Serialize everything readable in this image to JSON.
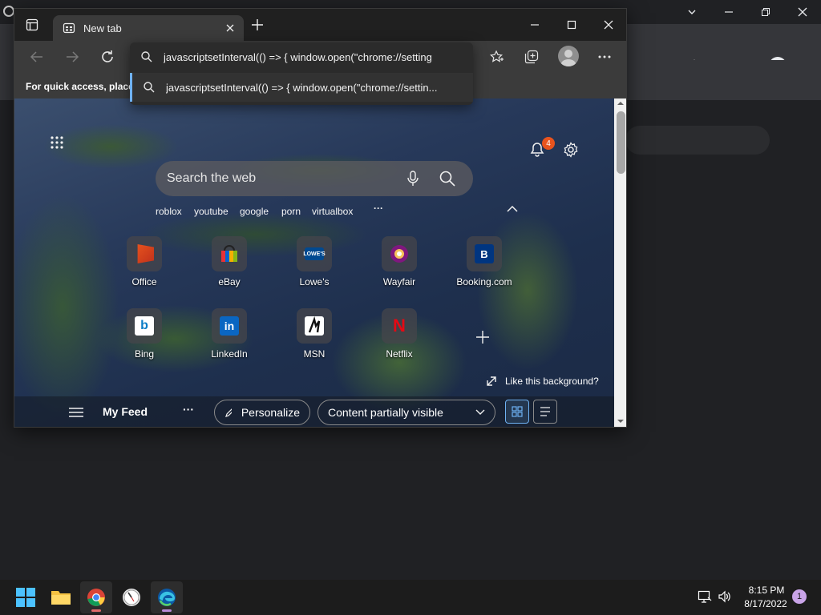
{
  "edge": {
    "tab_title": "New tab",
    "favorites_bar_text": "For quick access, place y",
    "omnibox": {
      "input_text": "javascriptsetInterval(() => { window.open(\"chrome://setting",
      "suggestion_text": "javascriptsetInterval(() => { window.open(\"chrome://settin..."
    },
    "ntp": {
      "search_placeholder": "Search the web",
      "notification_count": "4",
      "quick_links": [
        "roblox",
        "youtube",
        "google",
        "porn",
        "virtualbox"
      ],
      "quick_links_more": "···",
      "tiles": [
        {
          "label": "Office",
          "icon": "office-icon"
        },
        {
          "label": "eBay",
          "icon": "ebay-icon"
        },
        {
          "label": "Lowe's",
          "icon": "lowes-icon"
        },
        {
          "label": "Wayfair",
          "icon": "wayfair-icon"
        },
        {
          "label": "Booking.com",
          "icon": "booking-icon"
        },
        {
          "label": "Bing",
          "icon": "bing-icon"
        },
        {
          "label": "LinkedIn",
          "icon": "linkedin-icon"
        },
        {
          "label": "MSN",
          "icon": "msn-icon"
        },
        {
          "label": "Netflix",
          "icon": "netflix-icon"
        }
      ],
      "like_background": "Like this background?",
      "feed": {
        "title": "My Feed",
        "more": "···",
        "personalize": "Personalize",
        "content_visibility": "Content partially visible"
      }
    }
  },
  "taskbar": {
    "time": "8:15 PM",
    "date": "8/17/2022",
    "notifications": "1"
  },
  "colors": {
    "accent": "#6fb2f3",
    "badge": "#e8541e",
    "taskbar_indicator": "#b78ad8"
  }
}
